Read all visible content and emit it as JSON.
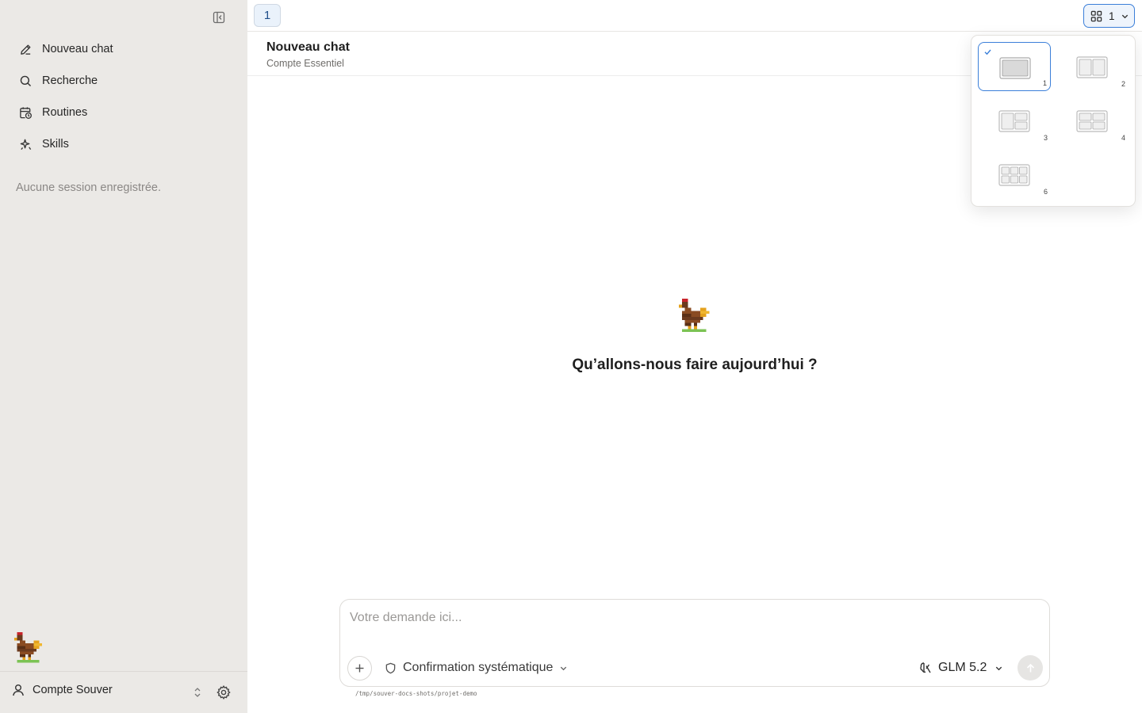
{
  "sidebar": {
    "nav": [
      {
        "label": "Nouveau chat",
        "icon": "pencil-icon"
      },
      {
        "label": "Recherche",
        "icon": "search-icon"
      },
      {
        "label": "Routines",
        "icon": "calendar-clock-icon"
      },
      {
        "label": "Skills",
        "icon": "sparkle-icon"
      }
    ],
    "empty_sessions": "Aucune session enregistrée.",
    "account_name": "Compte Souver"
  },
  "topbar": {
    "tab_label": "1",
    "layout_value": "1"
  },
  "header": {
    "title": "Nouveau chat",
    "subtitle": "Compte Essentiel"
  },
  "welcome": {
    "message": "Qu’allons-nous faire aujourd’hui ?"
  },
  "composer": {
    "placeholder": "Votre demande ici...",
    "confirmation_mode": "Confirmation systématique",
    "model": "GLM 5.2",
    "cwd": "/tmp/souver-docs-shots/projet-demo"
  },
  "layout_menu": {
    "options": [
      {
        "label": "1",
        "selected": true
      },
      {
        "label": "2",
        "selected": false
      },
      {
        "label": "3",
        "selected": false
      },
      {
        "label": "4",
        "selected": false
      },
      {
        "label": "6",
        "selected": false
      }
    ]
  },
  "colors": {
    "accent": "#3b7fd9",
    "sidebar_bg": "#ebe9e6"
  }
}
